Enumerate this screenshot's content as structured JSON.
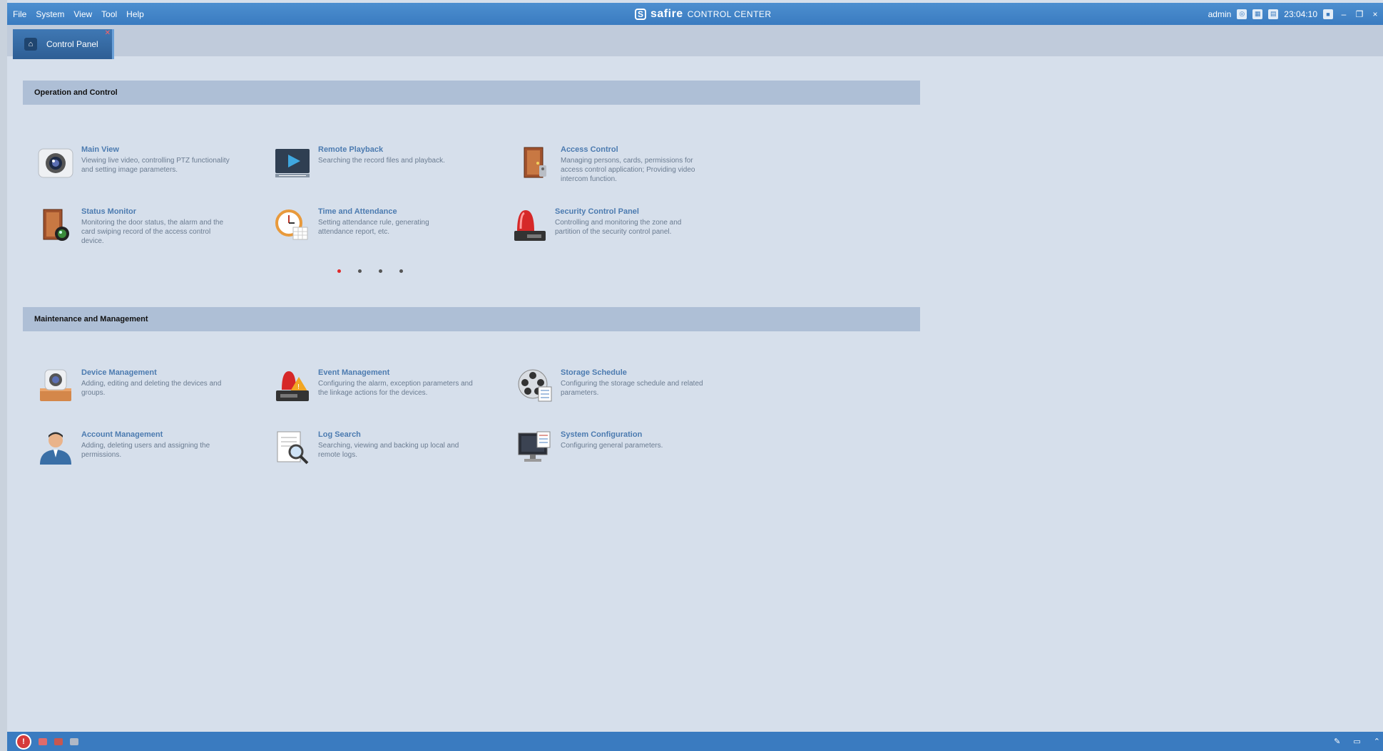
{
  "menu": {
    "items": [
      "File",
      "System",
      "View",
      "Tool",
      "Help"
    ]
  },
  "brand": {
    "logo": "safire",
    "subtitle": "CONTROL CENTER"
  },
  "tray": {
    "user": "admin",
    "time": "23:04:10"
  },
  "tabs": [
    {
      "label": "Control Panel"
    }
  ],
  "sections": [
    {
      "title": "Operation and Control",
      "items": [
        {
          "title": "Main View",
          "desc": "Viewing live video, controlling PTZ functionality and setting image parameters.",
          "icon": "camera-icon"
        },
        {
          "title": "Remote Playback",
          "desc": "Searching the record files and playback.",
          "icon": "playback-icon"
        },
        {
          "title": "Access Control",
          "desc": "Managing persons, cards, permissions for access control application; Providing video intercom function.",
          "icon": "door-icon"
        },
        {
          "title": "Status Monitor",
          "desc": "Monitoring the door status, the alarm and the card swiping record of the access control device.",
          "icon": "door-monitor-icon"
        },
        {
          "title": "Time and Attendance",
          "desc": "Setting attendance rule, generating attendance report, etc.",
          "icon": "clock-icon"
        },
        {
          "title": "Security Control Panel",
          "desc": "Controlling and monitoring the zone and partition of the security control panel.",
          "icon": "siren-icon"
        }
      ],
      "pager": {
        "pages": 4,
        "current": 1
      }
    },
    {
      "title": "Maintenance and Management",
      "items": [
        {
          "title": "Device Management",
          "desc": "Adding, editing and deleting the devices and groups.",
          "icon": "device-icon"
        },
        {
          "title": "Event Management",
          "desc": "Configuring the alarm, exception parameters and the linkage actions for the devices.",
          "icon": "event-icon"
        },
        {
          "title": "Storage Schedule",
          "desc": "Configuring the storage schedule and related parameters.",
          "icon": "film-reel-icon"
        },
        {
          "title": "Account Management",
          "desc": "Adding, deleting users and assigning the permissions.",
          "icon": "user-icon"
        },
        {
          "title": "Log Search",
          "desc": "Searching, viewing and backing up local and remote logs.",
          "icon": "log-search-icon"
        },
        {
          "title": "System Configuration",
          "desc": "Configuring general parameters.",
          "icon": "monitor-icon"
        }
      ]
    }
  ],
  "colors": {
    "titlebar": "#3a7bc0",
    "section_bar": "#aebfd6",
    "item_title": "#4c7bb0",
    "active_dot": "#e02a2a"
  }
}
